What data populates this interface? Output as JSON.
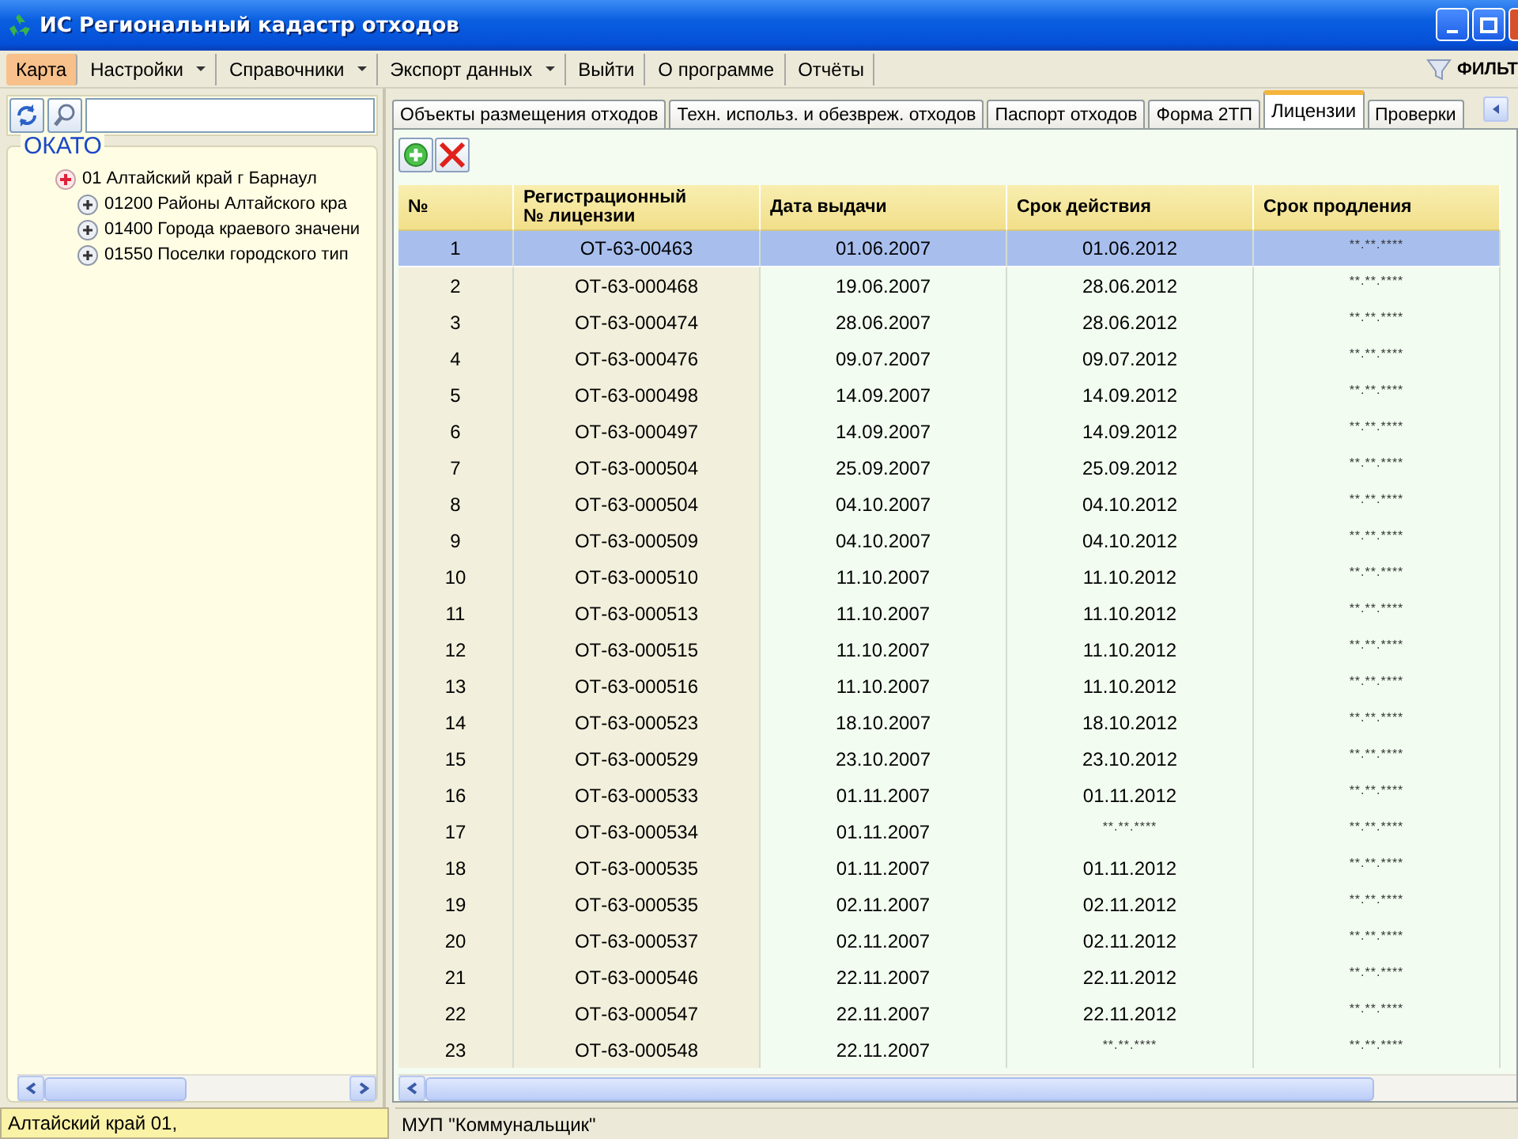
{
  "window": {
    "title": "ИС Региональный кадастр отходов"
  },
  "menu": [
    {
      "label": "Карта",
      "selected": true,
      "dropdown": false
    },
    {
      "label": "Настройки",
      "selected": false,
      "dropdown": true
    },
    {
      "label": "Справочники",
      "selected": false,
      "dropdown": true
    },
    {
      "label": "Экспорт данных",
      "selected": false,
      "dropdown": true
    },
    {
      "label": "Выйти",
      "selected": false,
      "dropdown": false
    },
    {
      "label": "О программе",
      "selected": false,
      "dropdown": false
    },
    {
      "label": "Отчёты",
      "selected": false,
      "dropdown": false
    }
  ],
  "filter_button": {
    "label": "ФИЛЬТ"
  },
  "tree": {
    "title": "ОКАТО",
    "items": [
      {
        "label": "01 Алтайский край г Барнаул",
        "children": [
          {
            "label": "01200 Районы Алтайского кра"
          },
          {
            "label": "01400 Города краевого значени"
          },
          {
            "label": "01550 Поселки городского тип"
          }
        ]
      }
    ]
  },
  "tabs": [
    {
      "label": "Объекты размещения отходов",
      "selected": false
    },
    {
      "label": "Техн. использ. и обезвреж. отходов",
      "selected": false
    },
    {
      "label": "Паспорт отходов",
      "selected": false
    },
    {
      "label": "Форма 2ТП",
      "selected": false
    },
    {
      "label": "Лицензии",
      "selected": true
    },
    {
      "label": "Проверки",
      "selected": false
    }
  ],
  "table": {
    "columns": [
      "№",
      "Регистрационный\n№ лицензии",
      "Дата выдачи",
      "Срок действия",
      "Срок продления"
    ],
    "rows": [
      {
        "selected": true,
        "cells": [
          "1",
          "ОТ-63-00463",
          "01.06.2007",
          "01.06.2012",
          "**.**.****"
        ]
      },
      {
        "selected": false,
        "cells": [
          "2",
          "ОТ-63-000468",
          "19.06.2007",
          "28.06.2012",
          "**.**.****"
        ]
      },
      {
        "selected": false,
        "cells": [
          "3",
          "ОТ-63-000474",
          "28.06.2007",
          "28.06.2012",
          "**.**.****"
        ]
      },
      {
        "selected": false,
        "cells": [
          "4",
          "ОТ-63-000476",
          "09.07.2007",
          "09.07.2012",
          "**.**.****"
        ]
      },
      {
        "selected": false,
        "cells": [
          "5",
          "ОТ-63-000498",
          "14.09.2007",
          "14.09.2012",
          "**.**.****"
        ]
      },
      {
        "selected": false,
        "cells": [
          "6",
          "ОТ-63-000497",
          "14.09.2007",
          "14.09.2012",
          "**.**.****"
        ]
      },
      {
        "selected": false,
        "cells": [
          "7",
          "ОТ-63-000504",
          "25.09.2007",
          "25.09.2012",
          "**.**.****"
        ]
      },
      {
        "selected": false,
        "cells": [
          "8",
          "ОТ-63-000504",
          "04.10.2007",
          "04.10.2012",
          "**.**.****"
        ]
      },
      {
        "selected": false,
        "cells": [
          "9",
          "ОТ-63-000509",
          "04.10.2007",
          "04.10.2012",
          "**.**.****"
        ]
      },
      {
        "selected": false,
        "cells": [
          "10",
          "ОТ-63-000510",
          "11.10.2007",
          "11.10.2012",
          "**.**.****"
        ]
      },
      {
        "selected": false,
        "cells": [
          "11",
          "ОТ-63-000513",
          "11.10.2007",
          "11.10.2012",
          "**.**.****"
        ]
      },
      {
        "selected": false,
        "cells": [
          "12",
          "ОТ-63-000515",
          "11.10.2007",
          "11.10.2012",
          "**.**.****"
        ]
      },
      {
        "selected": false,
        "cells": [
          "13",
          "ОТ-63-000516",
          "11.10.2007",
          "11.10.2012",
          "**.**.****"
        ]
      },
      {
        "selected": false,
        "cells": [
          "14",
          "ОТ-63-000523",
          "18.10.2007",
          "18.10.2012",
          "**.**.****"
        ]
      },
      {
        "selected": false,
        "cells": [
          "15",
          "ОТ-63-000529",
          "23.10.2007",
          "23.10.2012",
          "**.**.****"
        ]
      },
      {
        "selected": false,
        "cells": [
          "16",
          "ОТ-63-000533",
          "01.11.2007",
          "01.11.2012",
          "**.**.****"
        ]
      },
      {
        "selected": false,
        "cells": [
          "17",
          "ОТ-63-000534",
          "01.11.2007",
          "**.**.****",
          "**.**.****"
        ]
      },
      {
        "selected": false,
        "cells": [
          "18",
          "ОТ-63-000535",
          "01.11.2007",
          "01.11.2012",
          "**.**.****"
        ]
      },
      {
        "selected": false,
        "cells": [
          "19",
          "ОТ-63-000535",
          "02.11.2007",
          "02.11.2012",
          "**.**.****"
        ]
      },
      {
        "selected": false,
        "cells": [
          "20",
          "ОТ-63-000537",
          "02.11.2007",
          "02.11.2012",
          "**.**.****"
        ]
      },
      {
        "selected": false,
        "cells": [
          "21",
          "ОТ-63-000546",
          "22.11.2007",
          "22.11.2012",
          "**.**.****"
        ]
      },
      {
        "selected": false,
        "cells": [
          "22",
          "ОТ-63-000547",
          "22.11.2007",
          "22.11.2012",
          "**.**.****"
        ]
      },
      {
        "selected": false,
        "cells": [
          "23",
          "ОТ-63-000548",
          "22.11.2007",
          "**.**.****",
          "**.**.****"
        ]
      }
    ]
  },
  "status_bar": [
    "Алтайский край 01,",
    "МУП \"Коммунальщик\""
  ]
}
